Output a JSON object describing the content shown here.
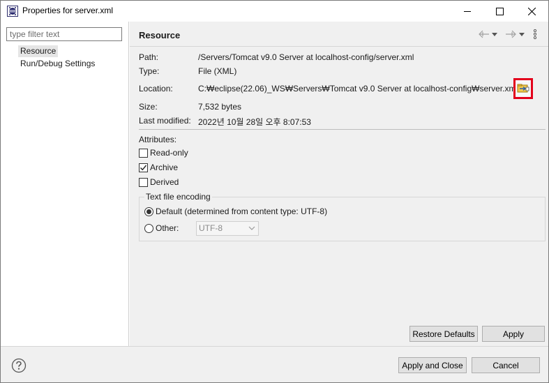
{
  "window": {
    "title": "Properties for server.xml"
  },
  "filter": {
    "placeholder": "type filter text"
  },
  "tree": {
    "items": [
      {
        "label": "Resource",
        "selected": true
      },
      {
        "label": "Run/Debug Settings",
        "selected": false
      }
    ]
  },
  "page": {
    "title": "Resource"
  },
  "properties": {
    "path_label": "Path:",
    "path_value": "/Servers/Tomcat v9.0 Server at localhost-config/server.xml",
    "type_label": "Type:",
    "type_value": "File  (XML)",
    "location_label": "Location:",
    "location_value": "C:₩eclipse(22.06)_WS₩Servers₩Tomcat v9.0 Server at localhost-config₩server.xml",
    "size_label": "Size:",
    "size_value": "7,532  bytes",
    "modified_label": "Last modified:",
    "modified_value": "2022년 10월 28일 오후 8:07:53"
  },
  "attributes": {
    "heading": "Attributes:",
    "readonly": {
      "label": "Read-only",
      "checked": false
    },
    "archive": {
      "label": "Archive",
      "checked": true
    },
    "derived": {
      "label": "Derived",
      "checked": false
    }
  },
  "encoding": {
    "group_title": "Text file encoding",
    "default_label": "Default (determined from content type: UTF-8)",
    "default_selected": true,
    "other_label": "Other:",
    "other_value": "UTF-8"
  },
  "buttons": {
    "restore_defaults": "Restore Defaults",
    "apply": "Apply",
    "apply_close": "Apply and Close",
    "cancel": "Cancel"
  },
  "colors": {
    "highlight_border": "#e3001b",
    "pane_background": "#f0f0f0"
  }
}
